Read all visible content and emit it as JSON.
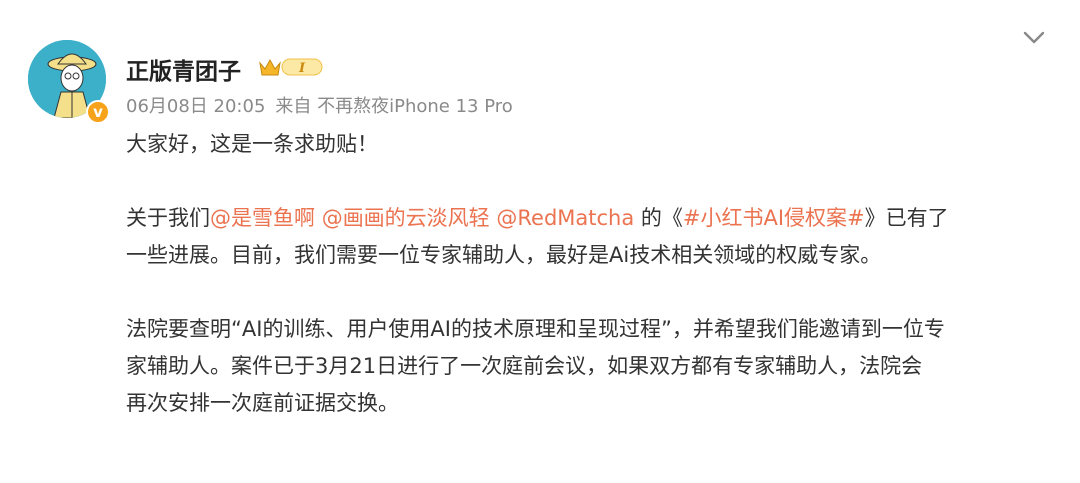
{
  "post": {
    "username": "正版青团子",
    "level": "I",
    "date": "06月08日 20:05",
    "source": "来自 不再熬夜iPhone 13 Pro",
    "verified_mark": "v",
    "avatar_icon": "cartoon-avatar-icon",
    "colors": {
      "accent": "#eb7350",
      "text": "#333333",
      "meta": "#8a8a8a",
      "avatar_bg": "#3cb0c9",
      "badge": "#f7a21b"
    }
  },
  "content": {
    "p1": "大家好，这是一条求助贴！",
    "p2_l1_prefix": "关于我们",
    "mention1": "@是雪鱼啊",
    "mention2": "@画画的云淡风轻",
    "mention3": "@RedMatcha",
    "p2_l1_mid": " 的《",
    "topic": "#小红书AI侵权案#",
    "p2_l1_suffix": "》已有了",
    "p2_l2": "一些进展。目前，我们需要一位专家辅助人，最好是Ai技术相关领域的权威专家。",
    "p3_l1": "法院要查明“AI的训练、用户使用AI的技术原理和呈现过程”，并希望我们能邀请到一位专",
    "p3_l2": "家辅助人。案件已于3月21日进行了一次庭前会议，如果双方都有专家辅助人，法院会",
    "p3_l3": "再次安排一次庭前证据交换。"
  }
}
